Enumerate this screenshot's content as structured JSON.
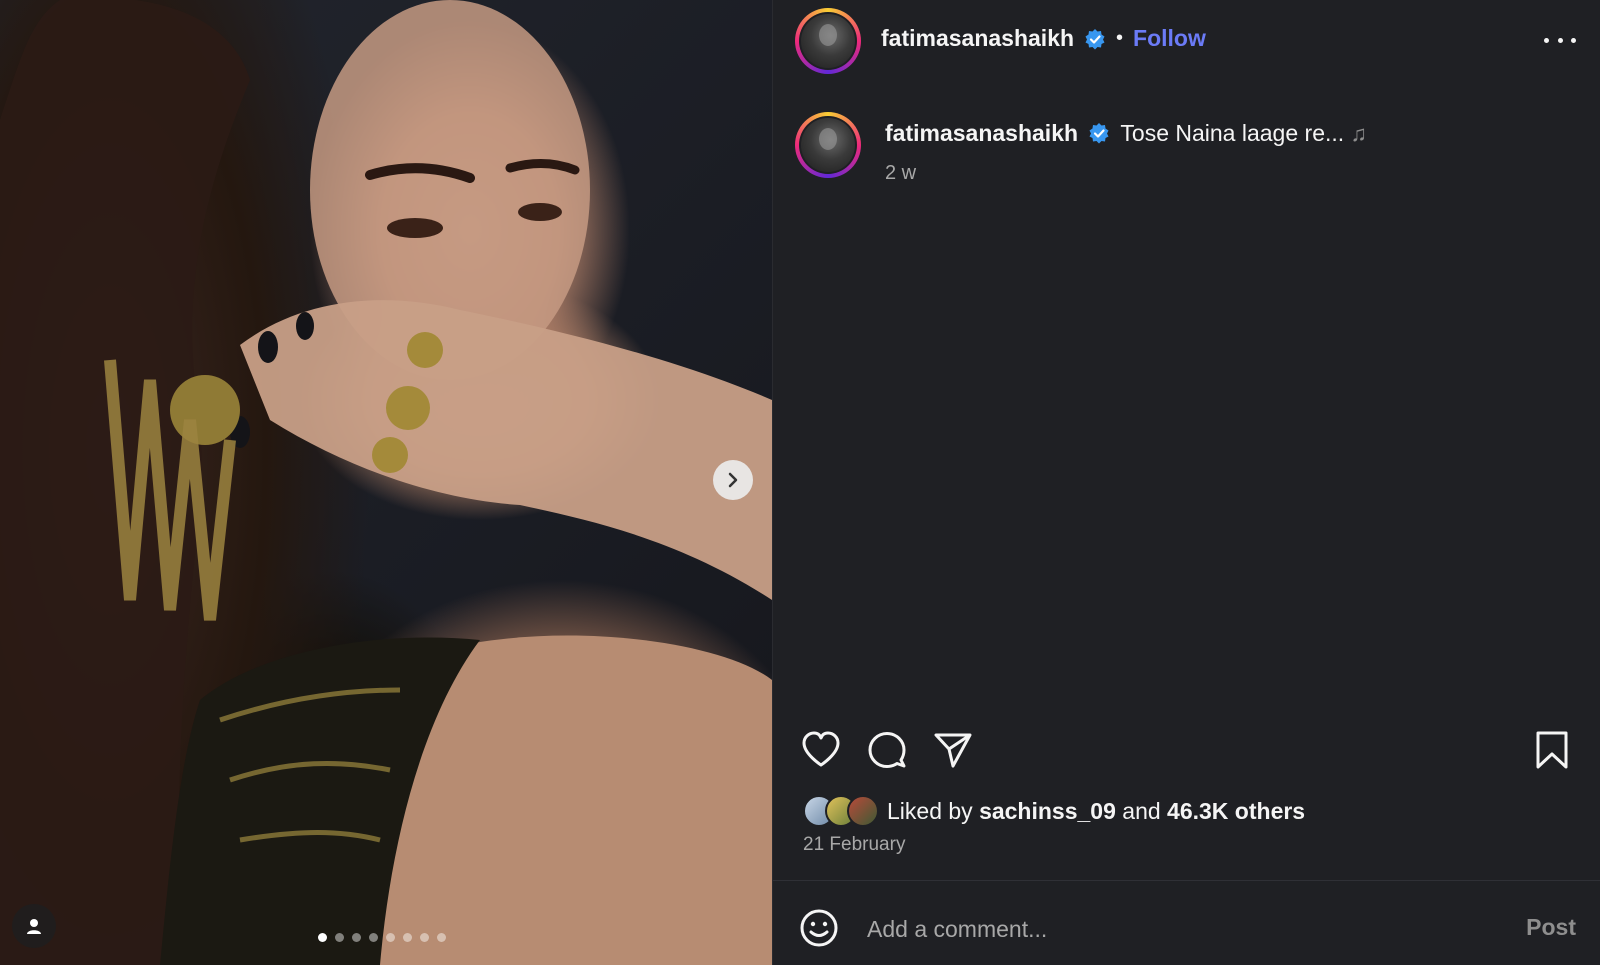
{
  "media": {
    "next_icon": "chevron-right-icon",
    "user_tag_icon": "person-icon",
    "carousel_dots": 8,
    "carousel_active_index": 0
  },
  "header": {
    "username": "fatimasanashaikh",
    "verified_icon": "verified-badge-icon",
    "separator": "•",
    "follow_label": "Follow",
    "more_icon": "more-options-icon"
  },
  "caption": {
    "username": "fatimasanashaikh",
    "text": "Tose Naina laage re...",
    "note_glyph": "♫",
    "time": "2 w"
  },
  "actions": {
    "like_icon": "heart-icon",
    "comment_icon": "comment-icon",
    "share_icon": "share-icon",
    "save_icon": "bookmark-icon"
  },
  "likes": {
    "prefix": "Liked by",
    "user": "sachinss_09",
    "conjunction": "and",
    "others": "46.3K others"
  },
  "date": "21 February",
  "comment": {
    "emoji_icon": "emoji-icon",
    "placeholder": "Add a comment...",
    "post_label": "Post"
  },
  "colors": {
    "panel_bg": "#1f2024",
    "follow_blue": "#6b7bf7",
    "verified_blue": "#3897f0"
  }
}
